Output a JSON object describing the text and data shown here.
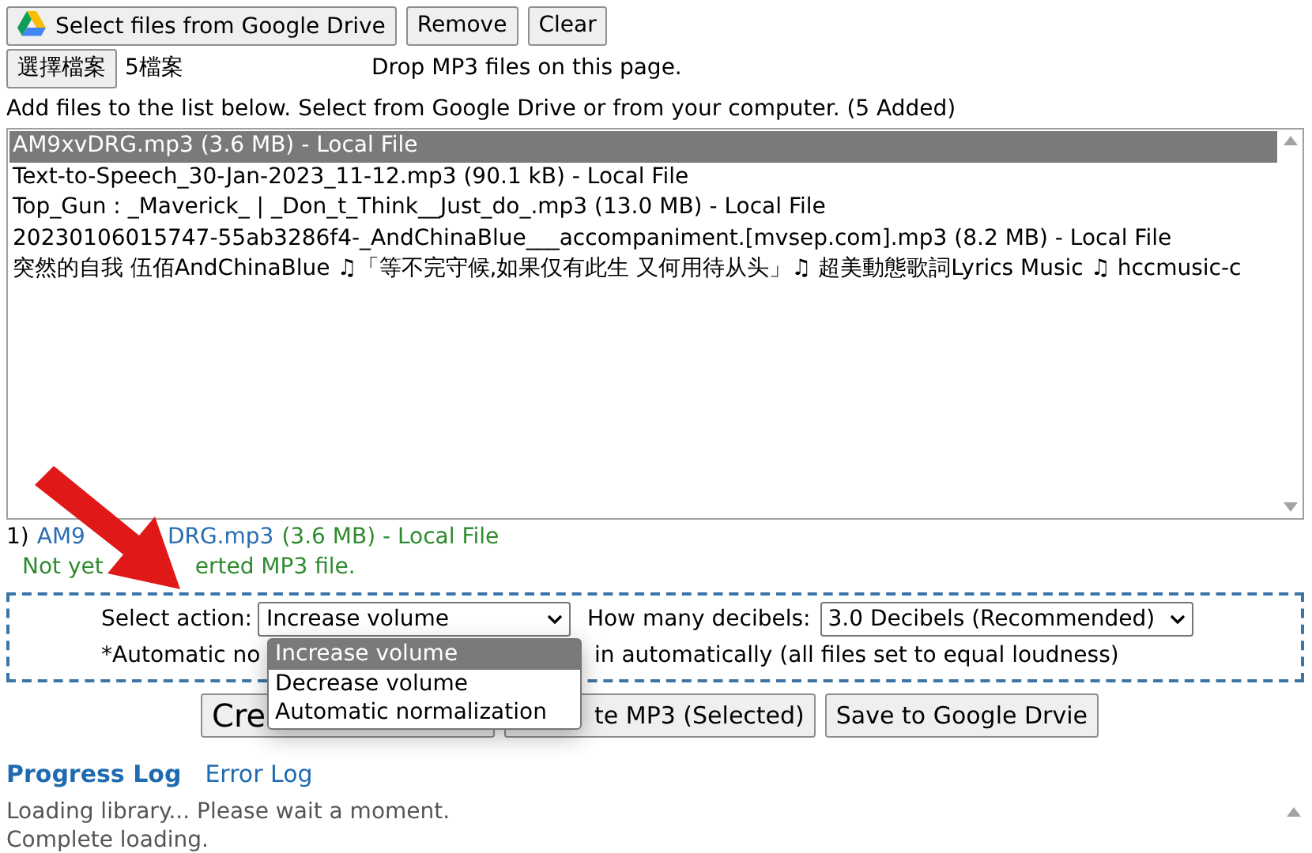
{
  "toolbar": [
    {
      "label": "Select files from Google Drive",
      "kind": "drive"
    },
    {
      "label": "Remove",
      "kind": "plain"
    },
    {
      "label": "Clear",
      "kind": "plain"
    }
  ],
  "file_input": {
    "button": "選擇檔案",
    "status": "5檔案"
  },
  "drop_hint": "Drop MP3 files on this page.",
  "instructions": "Add files to the list below. Select from Google Drive or from your computer. (5 Added)",
  "file_list": [
    {
      "label": "AM9xvDRG.mp3 (3.6 MB) - Local File",
      "selected": true
    },
    {
      "label": "Text-to-Speech_30-Jan-2023_11-12.mp3 (90.1 kB) - Local File",
      "selected": false
    },
    {
      "label": "Top_Gun : _Maverick_ | _Don_t_Think__Just_do_.mp3 (13.0 MB) - Local File",
      "selected": false
    },
    {
      "label": "20230106015747-55ab3286f4-_AndChinaBlue___accompaniment.[mvsep.com].mp3 (8.2 MB) - Local File",
      "selected": false
    },
    {
      "label": "突然的自我 伍佰AndChinaBlue ♫「等不完守候,如果仅有此生 又何用待从头」♫ 超美動態歌詞Lyrics Music ♫ hccmusic-c",
      "selected": false
    }
  ],
  "current_file": {
    "index": "1)",
    "name_parts": [
      "AM9",
      "DRG.mp3"
    ],
    "details": "(3.6 MB) - Local File",
    "status_parts": [
      "Not yet",
      "erted MP3 file."
    ]
  },
  "options": {
    "action_label": "Select action:",
    "action_value": "Increase volume",
    "decibels_label": "How many decibels:",
    "decibels_value": "3.0 Decibels (Recommended)",
    "note_parts": [
      "*Automatic no",
      "in automatically (all files set to equal loudness)"
    ]
  },
  "action_menu": [
    {
      "label": "Increase volume",
      "selected": true
    },
    {
      "label": "Decrease volume",
      "selected": false
    },
    {
      "label": "Automatic normalization",
      "selected": false
    }
  ],
  "actions": [
    {
      "label": "Cre",
      "kind": "large"
    },
    {
      "label": "te MP3 (Selected)",
      "kind": "plain"
    },
    {
      "label": "Save to Google Drvie",
      "kind": "plain"
    }
  ],
  "log_tabs": [
    {
      "label": "Progress Log",
      "selected": true
    },
    {
      "label": "Error Log",
      "selected": false
    }
  ],
  "log_lines": [
    "Loading library... Please wait a moment.",
    "Complete loading."
  ]
}
